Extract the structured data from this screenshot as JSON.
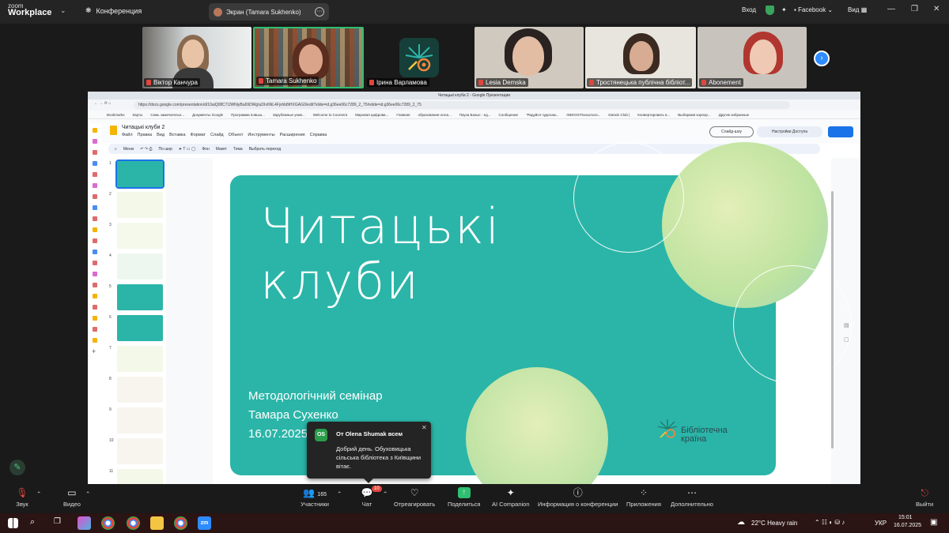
{
  "app": {
    "brand_line1": "zoom",
    "brand_line2": "Workplace"
  },
  "topbar": {
    "conference_label": "Конференция",
    "share_tab": "Экран (Tamara Sukhenko)",
    "signin": "Вход",
    "facebook": "Facebook",
    "view": "Вид"
  },
  "gallery": {
    "participants": [
      {
        "name": "Віктор Канчура"
      },
      {
        "name": "Tamara Sukhenko"
      },
      {
        "name": "Ірина Варламова"
      },
      {
        "name": "Lesia Demska"
      },
      {
        "name": "Тростянецька публічна бібліот..."
      },
      {
        "name": "Abonement"
      }
    ]
  },
  "browser": {
    "tab_title": "Читацькі клуби 2 - Google Презентации",
    "url": "https://docs.google.com/presentation/d/10aiQ08C7IJWNiyBu69DWgIuDIx6NL4Fjxhb8iHXGAG0/edit?slide=id.g36ee06c7289_2_75#slide=id.g36ee06c7289_2_75",
    "bookmarks": [
      "Bookmarks",
      "Карты",
      "Семь замечательн...",
      "Документы Google",
      "Программа повыш...",
      "Зарубежные унив...",
      "Welcome to Coursera",
      "Мировая цифрова...",
      "Главная",
      "образование-онла...",
      "Пауза Бахыс - ед...",
      "Сообщение",
      "\"Радуйся чудесам...",
      "INDIGO!Психологи...",
      "Darwin Club |",
      "Конвертировать в...",
      "Выбираем корпор...",
      "Другие избранные"
    ]
  },
  "doc": {
    "title": "Читацькі клуби 2",
    "menu": [
      "Файл",
      "Правка",
      "Вид",
      "Вставка",
      "Формат",
      "Слайд",
      "Объект",
      "Инструменты",
      "Расширения",
      "Справка"
    ],
    "slideshow_button": "Слайд-шоу",
    "access_button": "Настройки Доступа",
    "toolbar": [
      "Меню",
      "По шир",
      "Фон",
      "Макет",
      "Тема",
      "Выбрать переход"
    ],
    "slide_numbers": [
      "1",
      "2",
      "3",
      "4",
      "5",
      "6",
      "7",
      "8",
      "9",
      "10",
      "11"
    ]
  },
  "slide": {
    "title": "Читацькі\nклуби",
    "subtitle": "Методологічний семінар\nТамара Сухенко\n16.07.2025",
    "logo_text": "Бібліотечна\nкраїна",
    "colors": {
      "card": "#2bb5a8",
      "accent_circle": "#bfe3a0"
    }
  },
  "chat_popup": {
    "avatar": "OS",
    "from": "От Olena Shumak всем",
    "message": "Добрий день. Обуховицька сільська бібліотека з Київщини вітає."
  },
  "controls": {
    "audio": "Звук",
    "video": "Видео",
    "participants_count": "165",
    "participants": "Участники",
    "chat_badge": "10",
    "chat": "Чат",
    "react": "Отреагировать",
    "share": "Поделиться",
    "ai": "AI Companion",
    "info": "Информация о конференции",
    "apps": "Приложения",
    "more": "Дополнительно",
    "leave": "Выйти"
  },
  "taskbar": {
    "weather": "22°C  Heavy rain",
    "lang": "УКР",
    "time": "15:01",
    "date": "16.07.2025"
  }
}
